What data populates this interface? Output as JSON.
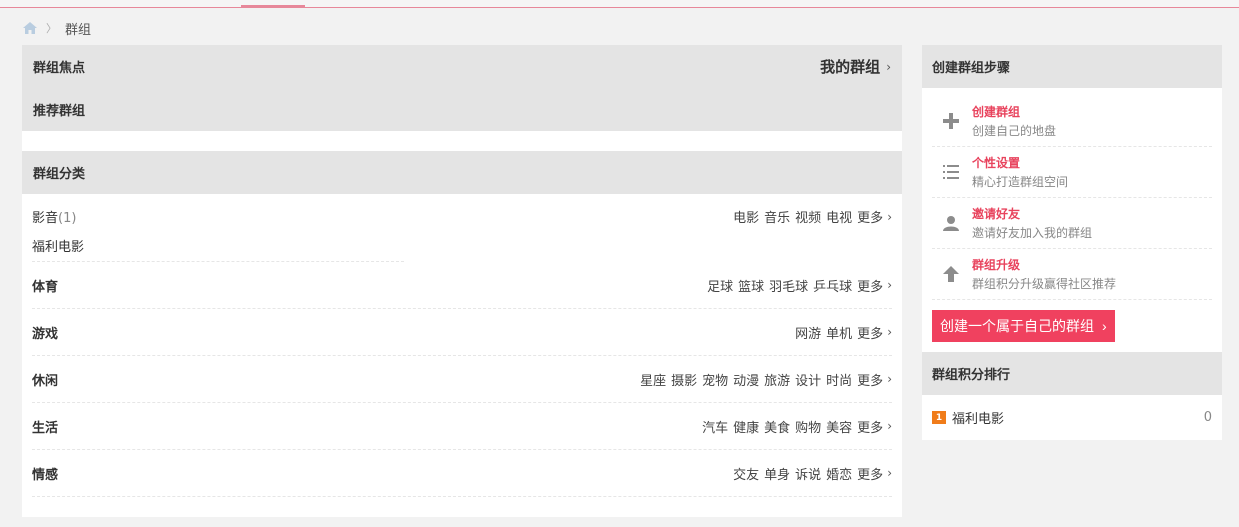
{
  "breadcrumb": {
    "current": "群组"
  },
  "main": {
    "focus_title": "群组焦点",
    "my_groups_label": "我的群组",
    "recommend_title": "推荐群组",
    "category_title": "群组分类",
    "more_label": "更多",
    "categories": [
      {
        "name": "影音",
        "count": "(1)",
        "sub_group": "福利电影",
        "tags": [
          "电影",
          "音乐",
          "视频",
          "电视"
        ]
      },
      {
        "name": "体育",
        "tags": [
          "足球",
          "篮球",
          "羽毛球",
          "乒乓球"
        ]
      },
      {
        "name": "游戏",
        "tags": [
          "网游",
          "单机"
        ]
      },
      {
        "name": "休闲",
        "tags": [
          "星座",
          "摄影",
          "宠物",
          "动漫",
          "旅游",
          "设计",
          "时尚"
        ]
      },
      {
        "name": "生活",
        "tags": [
          "汽车",
          "健康",
          "美食",
          "购物",
          "美容"
        ]
      },
      {
        "name": "情感",
        "tags": [
          "交友",
          "单身",
          "诉说",
          "婚恋"
        ]
      }
    ]
  },
  "side": {
    "steps_title": "创建群组步骤",
    "steps": [
      {
        "title": "创建群组",
        "desc": "创建自己的地盘",
        "icon": "plus-icon"
      },
      {
        "title": "个性设置",
        "desc": "精心打造群组空间",
        "icon": "list-icon"
      },
      {
        "title": "邀请好友",
        "desc": "邀请好友加入我的群组",
        "icon": "user-icon"
      },
      {
        "title": "群组升级",
        "desc": "群组积分升级赢得社区推荐",
        "icon": "arrow-up-icon"
      }
    ],
    "create_button": "创建一个属于自己的群组",
    "ranking_title": "群组积分排行",
    "ranking": [
      {
        "rank": "1",
        "name": "福利电影",
        "score": "0"
      }
    ]
  },
  "colors": {
    "accent": "#f0415f",
    "badge": "#f07c1a",
    "header_bg": "#e4e4e4"
  }
}
